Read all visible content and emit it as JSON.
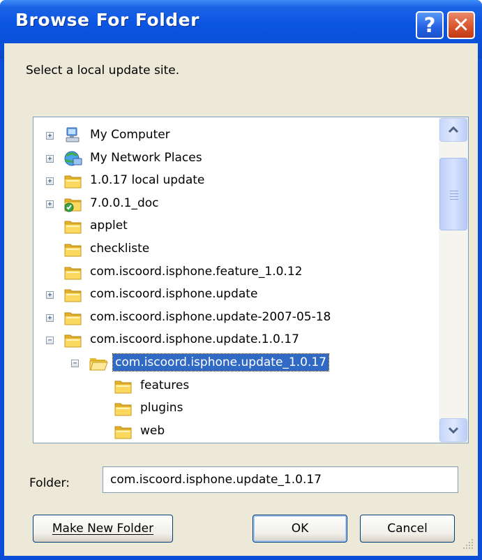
{
  "window": {
    "title": "Browse For Folder",
    "help_glyph": "?",
    "close_glyph": "✕"
  },
  "prompt": "Select a local update site.",
  "tree": {
    "items": [
      {
        "label": "My Computer",
        "expander": "+",
        "icon": "my-computer-icon"
      },
      {
        "label": "My Network Places",
        "expander": "+",
        "icon": "network-places-icon"
      },
      {
        "label": "1.0.17 local update",
        "expander": "+",
        "icon": "folder-icon"
      },
      {
        "label": "7.0.0.1_doc",
        "expander": "+",
        "icon": "shared-folder-icon"
      },
      {
        "label": "applet",
        "expander": "",
        "icon": "folder-icon"
      },
      {
        "label": "checkliste",
        "expander": "",
        "icon": "folder-icon"
      },
      {
        "label": "com.iscoord.isphone.feature_1.0.12",
        "expander": "",
        "icon": "folder-icon"
      },
      {
        "label": "com.iscoord.isphone.update",
        "expander": "+",
        "icon": "folder-icon"
      },
      {
        "label": "com.iscoord.isphone.update-2007-05-18",
        "expander": "+",
        "icon": "folder-icon"
      },
      {
        "label": "com.iscoord.isphone.update.1.0.17",
        "expander": "−",
        "icon": "folder-icon"
      },
      {
        "label": "com.iscoord.isphone.update_1.0.17",
        "expander": "−",
        "icon": "open-folder-icon",
        "selected": true
      },
      {
        "label": "features",
        "expander": "",
        "icon": "folder-icon"
      },
      {
        "label": "plugins",
        "expander": "",
        "icon": "folder-icon"
      },
      {
        "label": "web",
        "expander": "",
        "icon": "folder-icon"
      }
    ]
  },
  "folder": {
    "label": "Folder:",
    "value": "com.iscoord.isphone.update_1.0.17"
  },
  "buttons": {
    "make_new_folder": "Make New Folder",
    "ok": "OK",
    "cancel": "Cancel"
  },
  "colors": {
    "title_bar": "#0a4fd6",
    "dialog_bg": "#ece9d8",
    "selection": "#316ac5",
    "folder": "#f5c542"
  }
}
